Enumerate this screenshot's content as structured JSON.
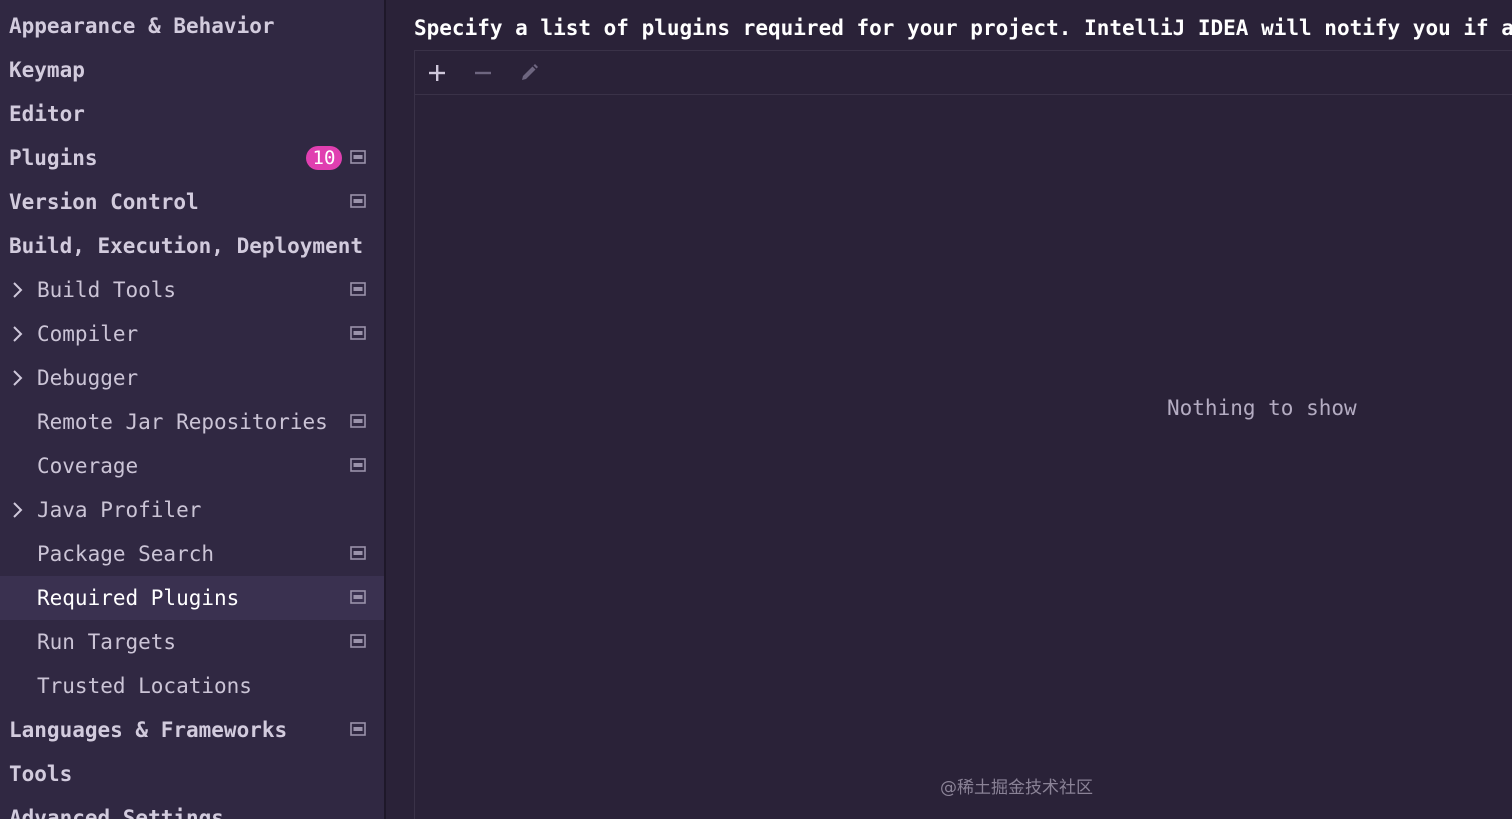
{
  "sidebar": {
    "items": [
      {
        "label": "Appearance & Behavior",
        "level": "top",
        "chevron": false,
        "project_icon": false
      },
      {
        "label": "Keymap",
        "level": "top",
        "chevron": false,
        "project_icon": false
      },
      {
        "label": "Editor",
        "level": "top",
        "chevron": false,
        "project_icon": false
      },
      {
        "label": "Plugins",
        "level": "top",
        "chevron": false,
        "project_icon": true,
        "badge": "10"
      },
      {
        "label": "Version Control",
        "level": "top",
        "chevron": false,
        "project_icon": true
      },
      {
        "label": "Build, Execution, Deployment",
        "level": "top",
        "chevron": false,
        "project_icon": false
      },
      {
        "label": "Build Tools",
        "level": "child",
        "chevron": true,
        "project_icon": true
      },
      {
        "label": "Compiler",
        "level": "child",
        "chevron": true,
        "project_icon": true
      },
      {
        "label": "Debugger",
        "level": "child",
        "chevron": true,
        "project_icon": false
      },
      {
        "label": "Remote Jar Repositories",
        "level": "child",
        "chevron": false,
        "project_icon": true
      },
      {
        "label": "Coverage",
        "level": "child",
        "chevron": false,
        "project_icon": true
      },
      {
        "label": "Java Profiler",
        "level": "child",
        "chevron": true,
        "project_icon": false
      },
      {
        "label": "Package Search",
        "level": "child",
        "chevron": false,
        "project_icon": true
      },
      {
        "label": "Required Plugins",
        "level": "child",
        "chevron": false,
        "project_icon": true,
        "selected": true
      },
      {
        "label": "Run Targets",
        "level": "child",
        "chevron": false,
        "project_icon": true
      },
      {
        "label": "Trusted Locations",
        "level": "child",
        "chevron": false,
        "project_icon": false
      },
      {
        "label": "Languages & Frameworks",
        "level": "top",
        "chevron": false,
        "project_icon": true
      },
      {
        "label": "Tools",
        "level": "top",
        "chevron": false,
        "project_icon": false
      },
      {
        "label": "Advanced Settings",
        "level": "top",
        "chevron": false,
        "project_icon": false
      }
    ]
  },
  "main": {
    "description": "Specify a list of plugins required for your project. IntelliJ IDEA will notify you if a",
    "toolbar": {
      "add_icon": "plus-icon",
      "remove_icon": "minus-icon",
      "edit_icon": "pencil-icon"
    },
    "empty_text": "Nothing to show"
  },
  "watermark": "@稀土掘金技术社区",
  "colors": {
    "background": "#2a2238",
    "sidebar": "#302842",
    "selected": "#3a3150",
    "badge": "#e03fb0"
  }
}
